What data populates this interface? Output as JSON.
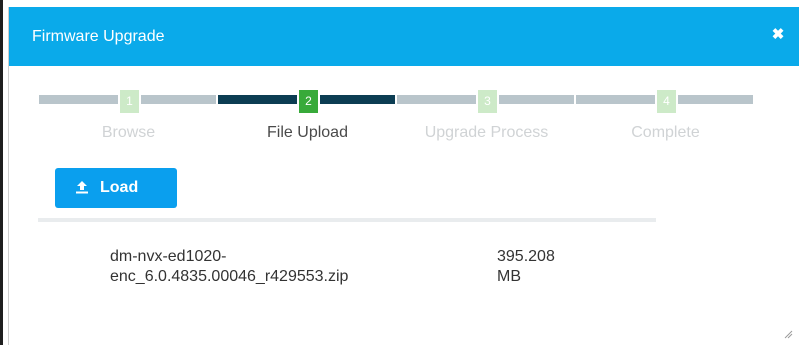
{
  "dialog": {
    "title": "Firmware Upgrade",
    "close_glyph": "✖",
    "accent_color": "#0aaaea"
  },
  "stepper": {
    "current_step": 2,
    "steps": [
      {
        "number": "1",
        "label": "Browse",
        "state": "inactive"
      },
      {
        "number": "2",
        "label": "File Upload",
        "state": "active"
      },
      {
        "number": "3",
        "label": "Upgrade Process",
        "state": "inactive"
      },
      {
        "number": "4",
        "label": "Complete",
        "state": "inactive"
      }
    ]
  },
  "toolbar": {
    "load_label": "Load",
    "load_icon": "upload-icon"
  },
  "files": [
    {
      "name_line1": "dm-nvx-ed1020-",
      "name_line2": "enc_6.0.4835.00046_r429553.zip",
      "size_line1": "395.208",
      "size_line2": "MB"
    }
  ]
}
